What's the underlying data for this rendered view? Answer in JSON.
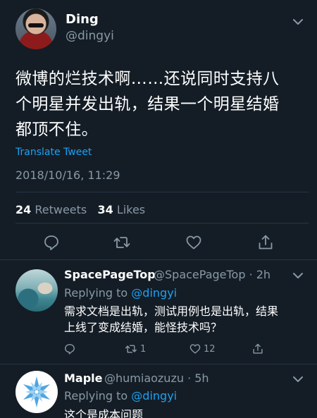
{
  "tweet": {
    "name": "Ding",
    "handle": "@dingyi",
    "text_lines": [
      "微博的烂技术啊……还说同时支持八",
      "个明星并发出轨，结果一个明星结婚",
      "都顶不住。"
    ],
    "translate_label": "Translate Tweet",
    "timestamp": "2018/10/16, 11:29",
    "retweets_count": "24",
    "retweets_label": "Retweets",
    "likes_count": "34",
    "likes_label": "Likes",
    "actions": [
      "reply-icon",
      "retweet-icon",
      "like-icon",
      "share-icon"
    ]
  },
  "replies": [
    {
      "name": "SpacePageTop",
      "meta": "@SpacePageTop · 2h",
      "replying_prefix": "Replying to ",
      "replying_to": "@dingyi",
      "text_lines": [
        "需求文档是出轨，测试用例也是出轨，结果",
        "上线了变成结婚，能怪技术吗？"
      ],
      "retweet_count": "1",
      "like_count": "12"
    },
    {
      "name": "Maple",
      "meta": "@humiaozuzu · 5h",
      "replying_prefix": "Replying to ",
      "replying_to": "@dingyi",
      "text_lines": [
        "这个是成本问题"
      ]
    }
  ],
  "colors": {
    "background": "#141d26",
    "secondary_text": "#8899a6",
    "link": "#1da1f2",
    "divider": "#263543"
  }
}
